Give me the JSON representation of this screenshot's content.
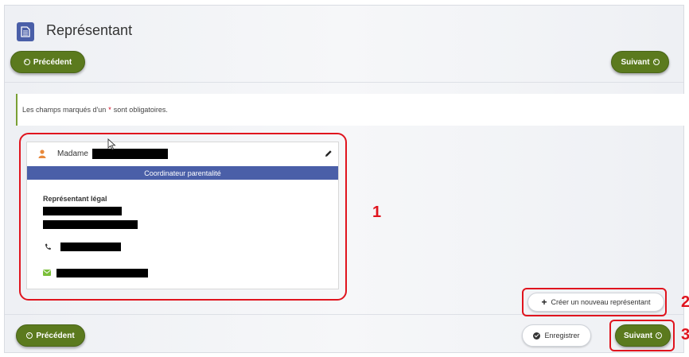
{
  "page": {
    "title": "Représentant",
    "title_icon": "document-icon"
  },
  "nav": {
    "prev_label": "Précédent",
    "next_label": "Suivant",
    "save_label": "Enregistrer",
    "create_label": "Créer un nouveau représentant"
  },
  "notice": {
    "before": "Les champs marqués d'un",
    "required_mark": "*",
    "after": "sont obligatoires."
  },
  "card": {
    "civility": "Madame",
    "role": "Coordinateur parentalité",
    "legal_label": "Représentant légal",
    "icons": [
      "person-icon",
      "pencil-icon",
      "phone-icon",
      "mail-icon"
    ]
  },
  "annotations": [
    "1",
    "2",
    "3"
  ],
  "colors": {
    "green": "#5b7a1e",
    "blue": "#4a5fa8",
    "annotation_red": "#e0141e",
    "person_orange": "#e8893c",
    "mail_green": "#7bbf3a"
  }
}
